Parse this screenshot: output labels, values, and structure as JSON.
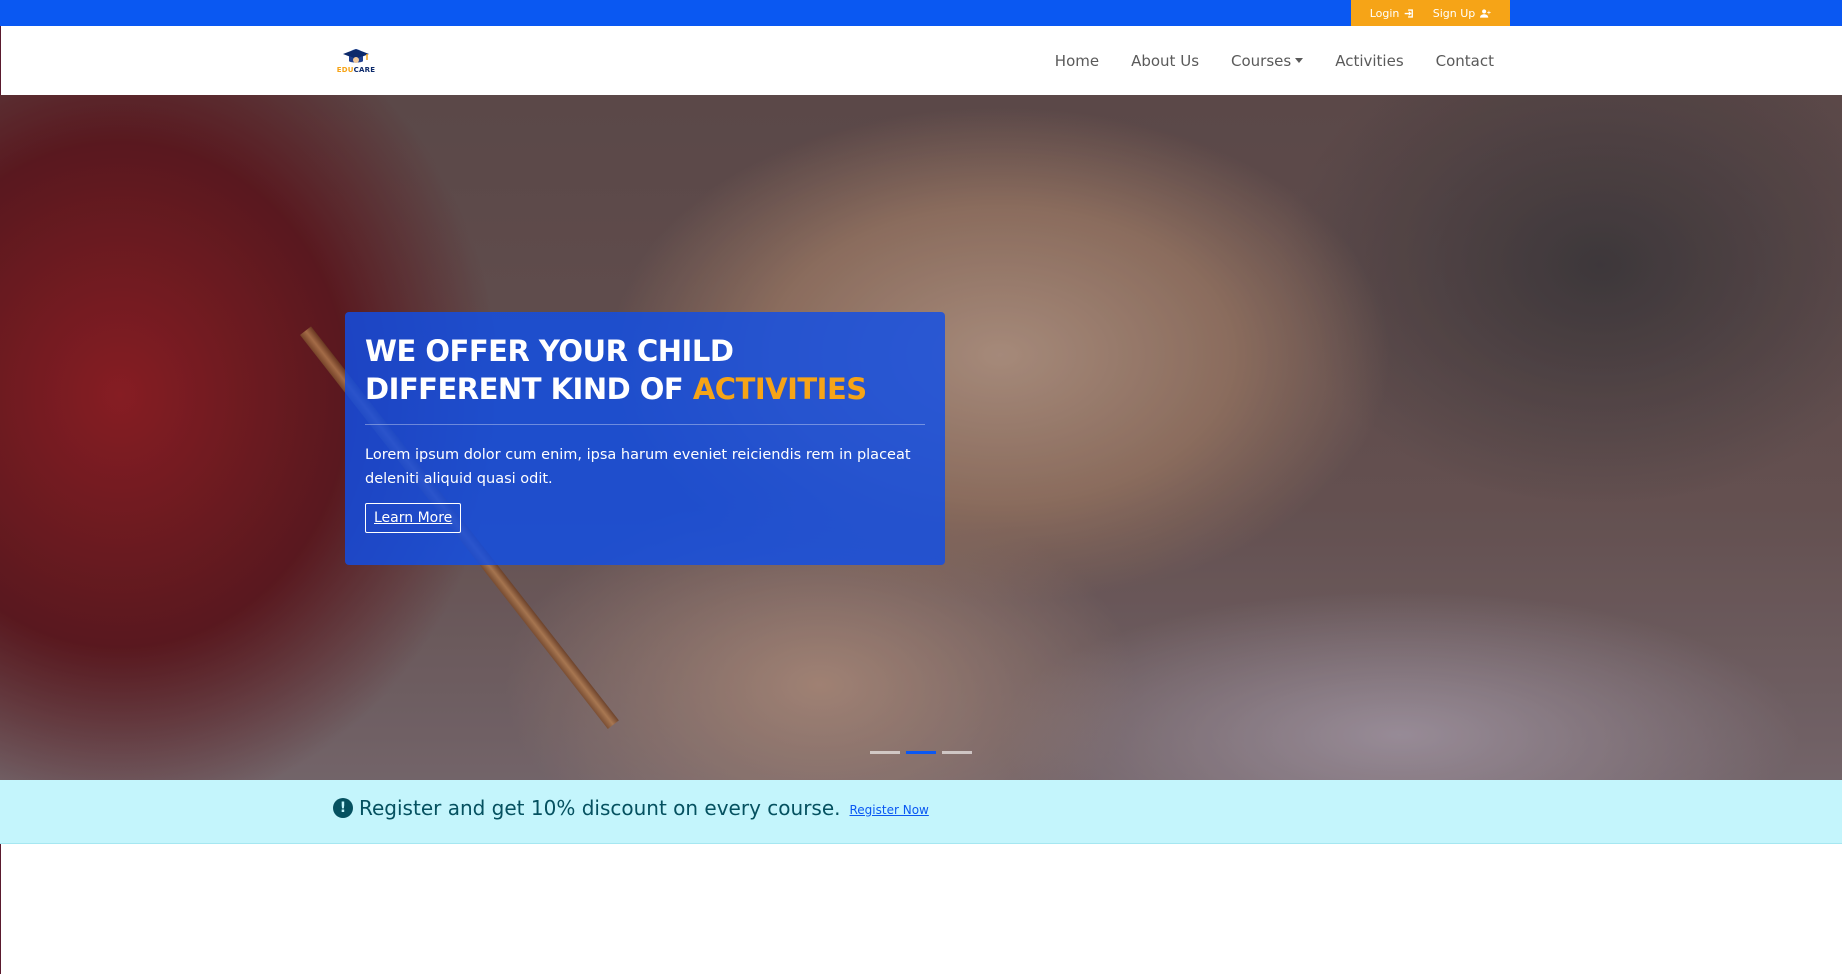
{
  "topbar": {
    "login_label": "Login",
    "signup_label": "Sign Up",
    "colors": {
      "bar": "#0a58f2",
      "auth_bg": "#f6a417"
    }
  },
  "brand": {
    "edu": "EDU",
    "care": "CARE",
    "icon": "graduation-cap-icon"
  },
  "nav": {
    "items": [
      {
        "label": "Home"
      },
      {
        "label": "About Us"
      },
      {
        "label": "Courses",
        "has_dropdown": true
      },
      {
        "label": "Activities"
      },
      {
        "label": "Contact"
      }
    ]
  },
  "hero": {
    "title_line1": "WE OFFER YOUR CHILD",
    "title_line2_prefix": "DIFFERENT KIND OF ",
    "title_line2_accent": "ACTIVITIES",
    "text": "Lorem ipsum dolor cum enim, ipsa harum eveniet reiciendis rem in placeat deleniti aliquid quasi odit.",
    "button_label": "Learn More",
    "slides_total": 3,
    "active_slide": 2,
    "accent_color": "#f6a417"
  },
  "promo": {
    "text": "Register and get 10% discount on every course.",
    "link_label": "Register Now",
    "icon": "exclamation-circle-icon"
  }
}
